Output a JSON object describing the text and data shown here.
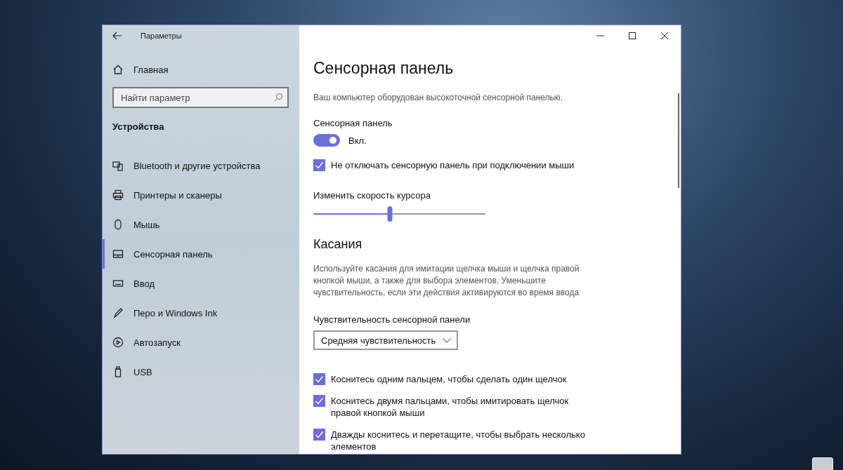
{
  "window": {
    "title": "Параметры"
  },
  "sidebar": {
    "home": "Главная",
    "search": {
      "placeholder": "Найти параметр"
    },
    "section": "Устройства",
    "items": [
      {
        "label": "Bluetooth и другие устройства",
        "kind": "bluetooth",
        "selected": false
      },
      {
        "label": "Принтеры и сканеры",
        "kind": "printer",
        "selected": false
      },
      {
        "label": "Мышь",
        "kind": "mouse",
        "selected": false
      },
      {
        "label": "Сенсорная панель",
        "kind": "touchpad",
        "selected": true
      },
      {
        "label": "Ввод",
        "kind": "keyboard",
        "selected": false
      },
      {
        "label": "Перо и Windows Ink",
        "kind": "pen",
        "selected": false
      },
      {
        "label": "Автозапуск",
        "kind": "autoplay",
        "selected": false
      },
      {
        "label": "USB",
        "kind": "usb",
        "selected": false
      }
    ]
  },
  "content": {
    "title": "Сенсорная панель",
    "description": "Ваш компьютер оборудован высокоточной сенсорной панелью.",
    "toggle": {
      "label": "Сенсорная панель",
      "on": true,
      "state_text": "Вкл."
    },
    "keep_on_checkbox": {
      "label": "Не отключать сенсорную панель при подключении мыши",
      "checked": true
    },
    "cursor_speed": {
      "label": "Изменить скорость курсора",
      "level": 0.445
    },
    "taps": {
      "heading": "Касания",
      "description": "Используйте касания для имитации щелчка мыши и щелчка правой кнопкой мыши, а также для выбора элементов. Уменьшите чувствительность, если эти действия активируются во время ввода",
      "sensitivity": {
        "label": "Чувствительность сенсорной панели",
        "value": "Средняя чувствительность"
      },
      "options": [
        {
          "label": "Коснитесь одним пальцем, чтобы сделать один щелчок",
          "checked": true
        },
        {
          "label": "Коснитесь двумя пальцами, чтобы имитировать щелчок правой кнопкой мыши",
          "checked": true
        },
        {
          "label": "Дважды коснитесь и перетащите, чтобы выбрать несколько элементов",
          "checked": true
        }
      ]
    }
  }
}
